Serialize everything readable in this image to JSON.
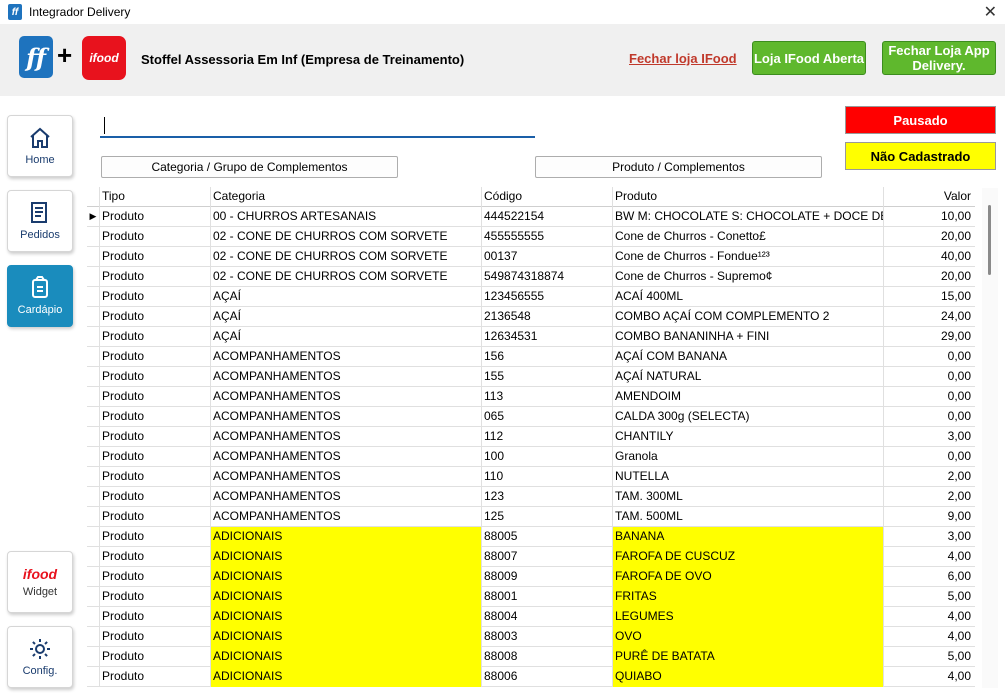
{
  "window": {
    "title": "Integrador Delivery",
    "app_icon": "ff"
  },
  "header": {
    "logo_text": "ff",
    "plus": "+",
    "ifood_logo": "ifood",
    "company": "Stoffel Assessoria Em Inf (Empresa de Treinamento)",
    "close_store_link": "Fechar loja IFood",
    "store_status_button": "Loja IFood Aberta",
    "close_app_button": "Fechar Loja App Delivery."
  },
  "sidebar": {
    "items": [
      {
        "label": "Home",
        "icon": "home-icon"
      },
      {
        "label": "Pedidos",
        "icon": "orders-icon"
      },
      {
        "label": "Cardápio",
        "icon": "menu-icon"
      },
      {
        "label": "Widget",
        "icon": "ifood-logo"
      },
      {
        "label": "Config.",
        "icon": "gear-icon"
      }
    ],
    "widget_logo": "ifood"
  },
  "toolbar": {
    "search_value": "",
    "category_button": "Categoria / Grupo de Complementos",
    "product_button": "Produto / Complementos"
  },
  "legend": {
    "paused": "Pausado",
    "not_registered": "Não Cadastrado",
    "paused_color": "#ff0000",
    "not_registered_color": "#ffff00"
  },
  "grid": {
    "columns": [
      "Tipo",
      "Categoria",
      "Código",
      "Produto",
      "Valor"
    ],
    "rows": [
      {
        "tipo": "Produto",
        "categoria": "00 - CHURROS ARTESANAIS",
        "codigo": "444522154",
        "produto": "BW M: CHOCOLATE S: CHOCOLATE + DOCE DE",
        "valor": "10,00",
        "current": true
      },
      {
        "tipo": "Produto",
        "categoria": "02 - CONE DE CHURROS COM SORVETE",
        "codigo": "455555555",
        "produto": "Cone de Churros - Conetto£",
        "valor": "20,00"
      },
      {
        "tipo": "Produto",
        "categoria": "02 - CONE DE CHURROS COM SORVETE",
        "codigo": "00137",
        "produto": "Cone de Churros - Fondue¹²³",
        "valor": "40,00"
      },
      {
        "tipo": "Produto",
        "categoria": "02 - CONE DE CHURROS COM SORVETE",
        "codigo": "549874318874",
        "produto": "Cone de Churros - Supremo¢",
        "valor": "20,00"
      },
      {
        "tipo": "Produto",
        "categoria": "AÇAÍ",
        "codigo": "123456555",
        "produto": "ACAÍ 400ML",
        "valor": "15,00"
      },
      {
        "tipo": "Produto",
        "categoria": "AÇAÍ",
        "codigo": "2136548",
        "produto": "COMBO AÇAÍ COM COMPLEMENTO 2",
        "valor": "24,00"
      },
      {
        "tipo": "Produto",
        "categoria": "AÇAÍ",
        "codigo": "12634531",
        "produto": "COMBO BANANINHA + FINI",
        "valor": "29,00"
      },
      {
        "tipo": "Produto",
        "categoria": "ACOMPANHAMENTOS",
        "codigo": "156",
        "produto": "AÇAÍ COM BANANA",
        "valor": "0,00"
      },
      {
        "tipo": "Produto",
        "categoria": "ACOMPANHAMENTOS",
        "codigo": "155",
        "produto": "AÇAÍ NATURAL",
        "valor": "0,00"
      },
      {
        "tipo": "Produto",
        "categoria": "ACOMPANHAMENTOS",
        "codigo": "113",
        "produto": "AMENDOIM",
        "valor": "0,00"
      },
      {
        "tipo": "Produto",
        "categoria": "ACOMPANHAMENTOS",
        "codigo": "065",
        "produto": "CALDA 300g (SELECTA)",
        "valor": "0,00"
      },
      {
        "tipo": "Produto",
        "categoria": "ACOMPANHAMENTOS",
        "codigo": "112",
        "produto": "CHANTILY",
        "valor": "3,00"
      },
      {
        "tipo": "Produto",
        "categoria": "ACOMPANHAMENTOS",
        "codigo": "100",
        "produto": "Granola",
        "valor": "0,00"
      },
      {
        "tipo": "Produto",
        "categoria": "ACOMPANHAMENTOS",
        "codigo": "110",
        "produto": "NUTELLA",
        "valor": "2,00"
      },
      {
        "tipo": "Produto",
        "categoria": "ACOMPANHAMENTOS",
        "codigo": "123",
        "produto": "TAM. 300ML",
        "valor": "2,00"
      },
      {
        "tipo": "Produto",
        "categoria": "ACOMPANHAMENTOS",
        "codigo": "125",
        "produto": "TAM. 500ML",
        "valor": "9,00"
      },
      {
        "tipo": "Produto",
        "categoria": "ADICIONAIS",
        "codigo": "88005",
        "produto": "BANANA",
        "valor": "3,00",
        "not_registered": true
      },
      {
        "tipo": "Produto",
        "categoria": "ADICIONAIS",
        "codigo": "88007",
        "produto": "FAROFA DE CUSCUZ",
        "valor": "4,00",
        "not_registered": true
      },
      {
        "tipo": "Produto",
        "categoria": "ADICIONAIS",
        "codigo": "88009",
        "produto": "FAROFA DE OVO",
        "valor": "6,00",
        "not_registered": true
      },
      {
        "tipo": "Produto",
        "categoria": "ADICIONAIS",
        "codigo": "88001",
        "produto": "FRITAS",
        "valor": "5,00",
        "not_registered": true
      },
      {
        "tipo": "Produto",
        "categoria": "ADICIONAIS",
        "codigo": "88004",
        "produto": "LEGUMES",
        "valor": "4,00",
        "not_registered": true
      },
      {
        "tipo": "Produto",
        "categoria": "ADICIONAIS",
        "codigo": "88003",
        "produto": "OVO",
        "valor": "4,00",
        "not_registered": true
      },
      {
        "tipo": "Produto",
        "categoria": "ADICIONAIS",
        "codigo": "88008",
        "produto": "PURÊ DE BATATA",
        "valor": "5,00",
        "not_registered": true
      },
      {
        "tipo": "Produto",
        "categoria": "ADICIONAIS",
        "codigo": "88006",
        "produto": "QUIABO",
        "valor": "4,00",
        "not_registered": true
      }
    ]
  }
}
